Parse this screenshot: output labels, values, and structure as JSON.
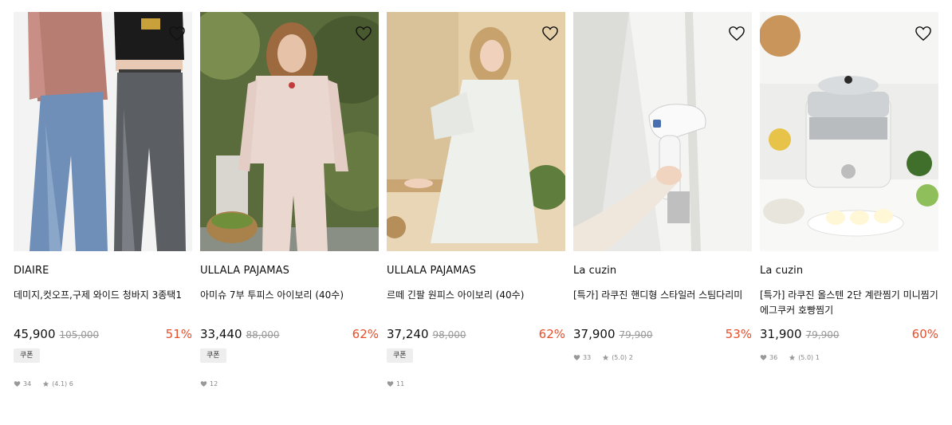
{
  "products": [
    {
      "brand": "DIAIRE",
      "title": "데미지,컷오프,구제 와이드 청바지 3종택1",
      "price": "45,900",
      "original_price": "105,000",
      "discount": "51%",
      "badge": "쿠폰",
      "likes": "34",
      "rating": "(4.1) 6",
      "image": "two-models-wide-jeans"
    },
    {
      "brand": "ULLALA PAJAMAS",
      "title": "아미슈 7부 투피스 아이보리 (40수)",
      "price": "33,440",
      "original_price": "88,000",
      "discount": "62%",
      "badge": "쿠폰",
      "likes": "12",
      "rating": "",
      "image": "floral-pajama-garden"
    },
    {
      "brand": "ULLALA PAJAMAS",
      "title": "르떼 긴팔 원피스 아이보리 (40수)",
      "price": "37,240",
      "original_price": "98,000",
      "discount": "62%",
      "badge": "쿠폰",
      "likes": "11",
      "rating": "",
      "image": "floral-nightdress-seated"
    },
    {
      "brand": "La cuzin",
      "title": "[특가] 라쿠진 핸디형 스타일러 스팀다리미",
      "price": "37,900",
      "original_price": "79,900",
      "discount": "53%",
      "badge": "",
      "likes": "33",
      "rating": "(5.0) 2",
      "image": "handheld-steamer-shirt"
    },
    {
      "brand": "La cuzin",
      "title": "[특가] 라쿠진 올스텐 2단 계란찜기 미니찜기 에그쿠커 호빵찜기",
      "price": "31,900",
      "original_price": "79,900",
      "discount": "60%",
      "badge": "",
      "likes": "36",
      "rating": "(5.0) 1",
      "image": "stainless-egg-steamer"
    }
  ],
  "colors": {
    "discount": "#e84f2a",
    "strike": "#999999",
    "meta": "#888888"
  },
  "icons": {
    "wish": "heart-outline-icon",
    "likes": "heart-icon",
    "rating": "star-icon"
  }
}
